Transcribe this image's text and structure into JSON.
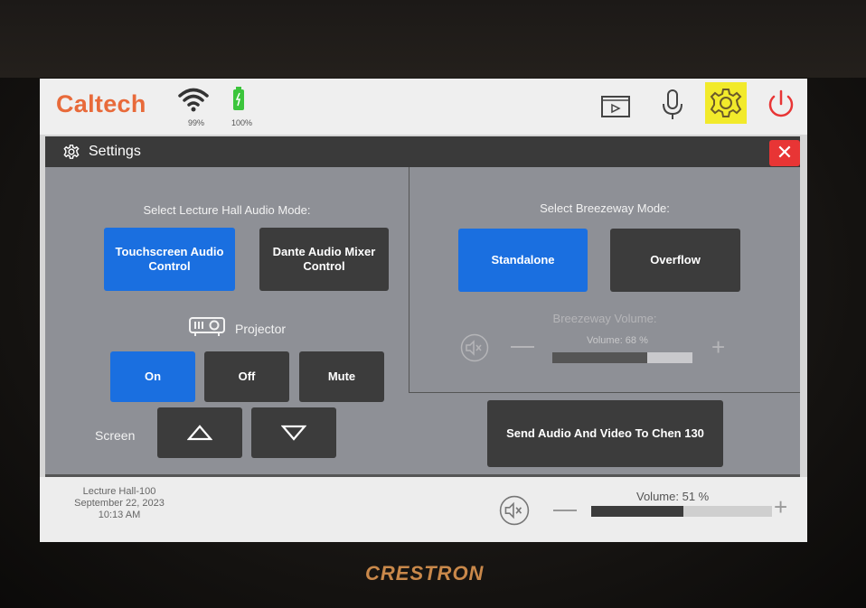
{
  "header": {
    "brand": "Caltech",
    "wifi_pct": "99%",
    "battery_pct": "100%",
    "icons": [
      "video-source-icon",
      "microphone-icon",
      "gear-icon",
      "power-icon"
    ],
    "highlight_color": "#f2ea2b"
  },
  "settings": {
    "title": "Settings",
    "close_label": "✕",
    "audio_mode": {
      "title": "Select Lecture Hall Audio Mode:",
      "options": [
        "Touchscreen Audio Control",
        "Dante Audio Mixer Control"
      ],
      "selected": 0
    },
    "projector": {
      "label": "Projector",
      "buttons": [
        "On",
        "Off",
        "Mute"
      ],
      "selected": 0
    },
    "screen": {
      "label": "Screen",
      "up_icon": "triangle-up-icon",
      "down_icon": "triangle-down-icon"
    },
    "breezeway": {
      "title": "Select Breezeway Mode:",
      "options": [
        "Standalone",
        "Overflow"
      ],
      "selected": 0,
      "volume_title": "Breezeway Volume:",
      "volume_text": "Volume: 68 %",
      "volume": 68
    },
    "send_button": "Send Audio And Video To Chen 130"
  },
  "footer": {
    "room": "Lecture Hall-100",
    "date": "September 22, 2023",
    "time": "10:13 AM",
    "volume_text": "Volume: 51 %",
    "volume": 51
  },
  "bezel": {
    "brand": "CRESTRON"
  },
  "colors": {
    "accent_blue": "#1a6fe0",
    "brand_orange": "#e86a3a",
    "close_red": "#e83535"
  }
}
